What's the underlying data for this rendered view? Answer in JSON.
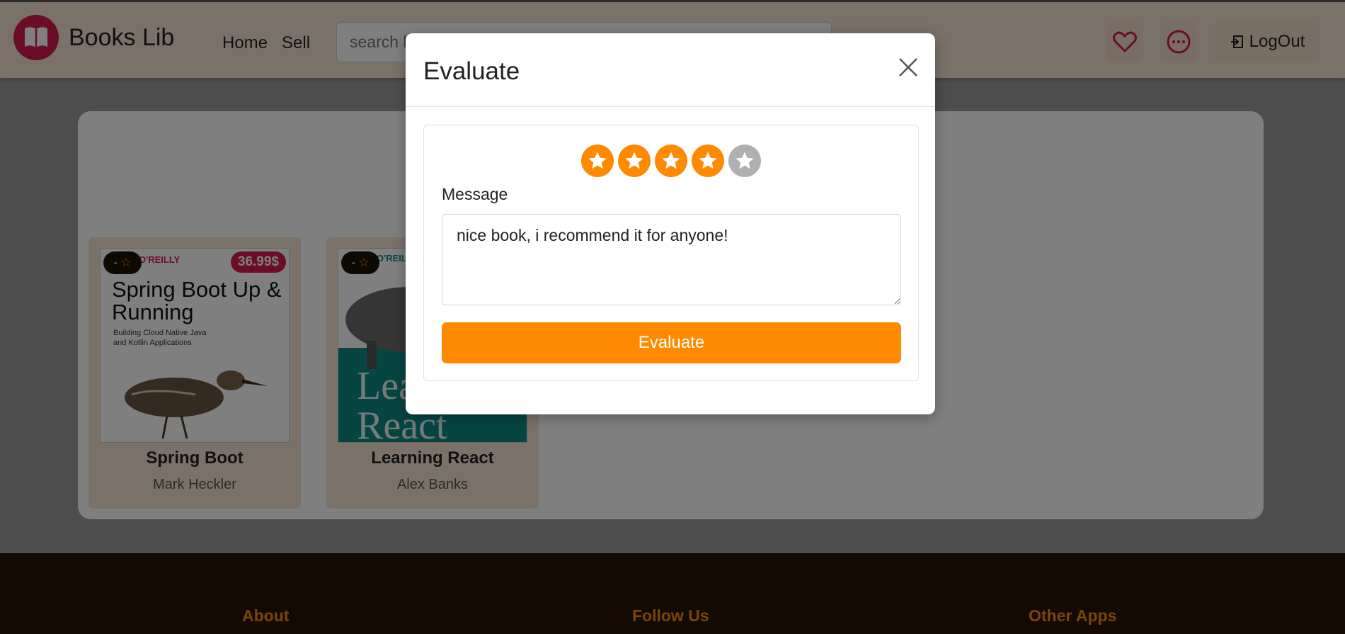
{
  "navbar": {
    "brand": "Books Lib",
    "links": [
      "Home",
      "Sell"
    ],
    "search_placeholder": "search books",
    "logout_label": "LogOut"
  },
  "books": [
    {
      "title": "Spring Boot",
      "author": "Mark Heckler",
      "price": "36.99$",
      "rating": "-",
      "cover_heading": "Spring Boot Up & Running",
      "cover_sub": "Building Cloud Native Java and Kotlin Applications",
      "cover_publisher": "O'REILLY"
    },
    {
      "title": "Learning React",
      "author": "Alex Banks",
      "rating": "-",
      "cover_heading": "Learning React",
      "cover_publisher": "O'REILLY"
    }
  ],
  "footer": {
    "about": "About",
    "follow": "Follow Us",
    "apps": "Other Apps"
  },
  "modal": {
    "title": "Evaluate",
    "rating": 4,
    "max_rating": 5,
    "message_label": "Message",
    "message_value": "nice book, i recommend it for anyone!",
    "submit_label": "Evaluate"
  },
  "colors": {
    "accent": "#ff8a00",
    "brand": "#d81b50",
    "star_inactive": "#b0b0b0"
  }
}
